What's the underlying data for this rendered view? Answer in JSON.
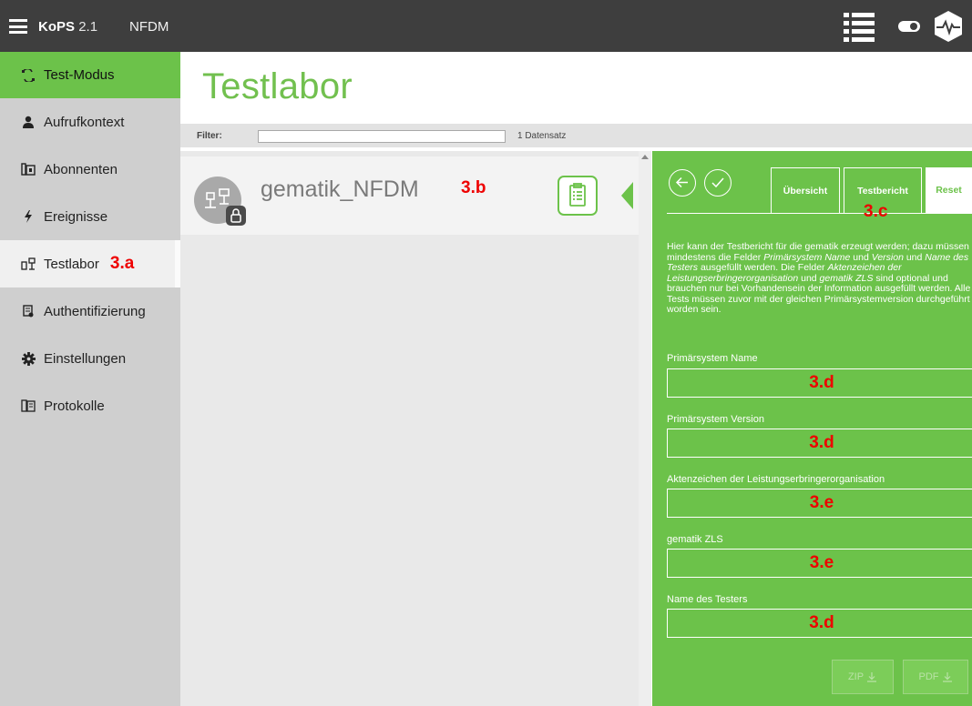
{
  "topbar": {
    "brand": "KoPS",
    "version": "2.1",
    "module": "NFDM",
    "icons": [
      "menu-icon",
      "list-view-icon",
      "toggle-icon",
      "heartbeat-logo-icon"
    ]
  },
  "sidebar": {
    "items": [
      {
        "label": "Test-Modus",
        "icon": "test-mode-icon",
        "state": "active-mode"
      },
      {
        "label": "Aufrufkontext",
        "icon": "user-icon"
      },
      {
        "label": "Abonnenten",
        "icon": "subscribers-icon"
      },
      {
        "label": "Ereignisse",
        "icon": "lightning-icon"
      },
      {
        "label": "Testlabor",
        "icon": "lab-icon",
        "state": "current",
        "annotation": "3.a"
      },
      {
        "label": "Authentifizierung",
        "icon": "certificate-icon"
      },
      {
        "label": "Einstellungen",
        "icon": "gear-icon"
      },
      {
        "label": "Protokolle",
        "icon": "log-icon"
      }
    ]
  },
  "main": {
    "title": "Testlabor",
    "filter": {
      "label": "Filter:",
      "value": "",
      "count": "1 Datensatz"
    },
    "list": [
      {
        "name": "gematik_NFDM",
        "annotation": "3.b"
      }
    ]
  },
  "panel": {
    "tabs": [
      {
        "label": "Übersicht"
      },
      {
        "label": "Testbericht",
        "active": true,
        "annotation": "3.c"
      },
      {
        "label": "Reset"
      }
    ],
    "description": {
      "t1": "Hier kann der Testbericht für die gematik erzeugt werden; dazu müssen mindestens die Felder ",
      "e1": "Primärsystem Name",
      "t2": " und ",
      "e2": "Version",
      "t3": " und ",
      "e3": "Name des Testers",
      "t4": " ausgefüllt werden. Die Felder ",
      "e4": "Aktenzeichen der Leistungserbringerorganisation",
      "t5": " und ",
      "e5": "gematik ZLS",
      "t6": " sind optional und brauchen nur bei Vorhandensein der Information ausgefüllt werden. Alle Tests müssen zuvor mit der gleichen Primärsystemversion durchgeführt worden sein."
    },
    "fields": [
      {
        "label": "Primärsystem Name",
        "annotation": "3.d",
        "value": ""
      },
      {
        "label": "Primärsystem Version",
        "annotation": "3.d",
        "value": ""
      },
      {
        "label": "Aktenzeichen der Leistungserbringerorganisation",
        "annotation": "3.e",
        "value": ""
      },
      {
        "label": "gematik ZLS",
        "annotation": "3.e",
        "value": ""
      },
      {
        "label": "Name des Testers",
        "annotation": "3.d",
        "value": ""
      }
    ],
    "buttons": {
      "zip": "ZIP",
      "pdf": "PDF"
    }
  },
  "colors": {
    "accent_green": "#6cc24a",
    "topbar_bg": "#3e3e3e",
    "sidebar_bg": "#cfcfcf",
    "annotation_red": "#e00000"
  }
}
